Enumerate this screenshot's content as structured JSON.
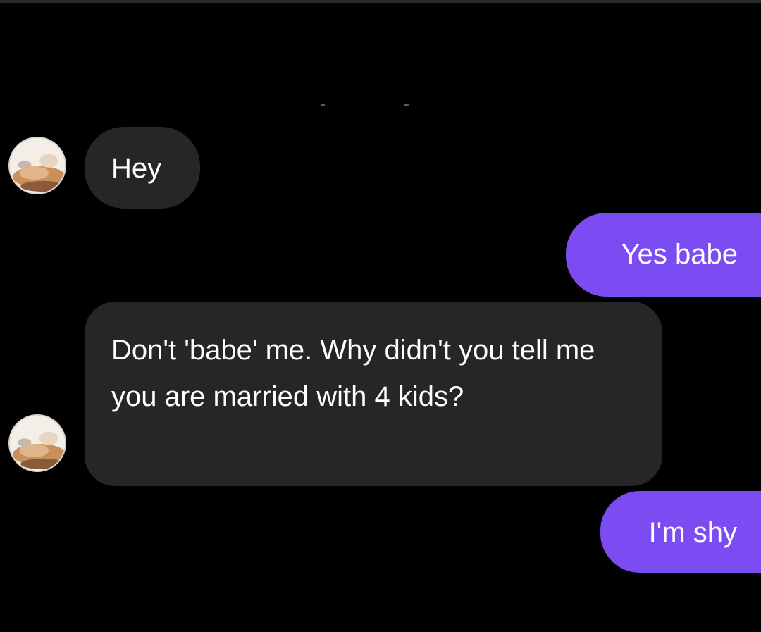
{
  "messages": [
    {
      "sender": "them",
      "text": "Hey"
    },
    {
      "sender": "me",
      "text": "Yes babe"
    },
    {
      "sender": "them",
      "text": "Don't 'babe' me. Why didn't you tell me you are married with 4 kids?"
    },
    {
      "sender": "me",
      "text": "I'm shy"
    }
  ],
  "colors": {
    "background": "#000000",
    "incoming_bubble": "#262626",
    "outgoing_bubble": "#7b4cf2",
    "text": "#ffffff"
  },
  "icons": {
    "avatar": "contact-avatar"
  }
}
